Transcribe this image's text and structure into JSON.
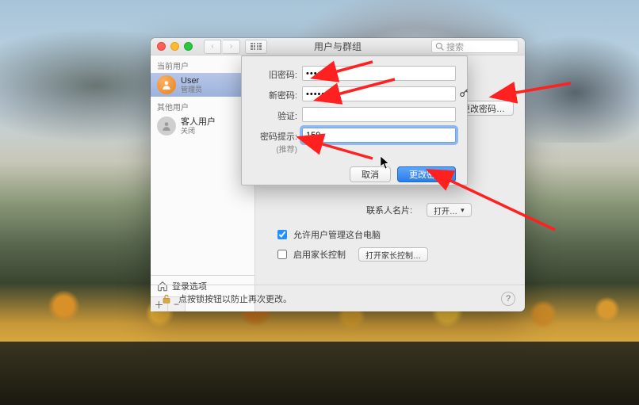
{
  "titlebar": {
    "title": "用户与群组",
    "search_placeholder": "搜索"
  },
  "sidebar": {
    "current_header": "当前用户",
    "other_header": "其他用户",
    "users": [
      {
        "name": "User",
        "sub": "管理员"
      },
      {
        "name": "客人用户",
        "sub": "关闭"
      }
    ],
    "login_options": "登录选项"
  },
  "content": {
    "change_pw_btn": "更改密码…",
    "contact_label": "联系人名片:",
    "open_btn": "打开…",
    "allow_admin_label": "允许用户管理这台电脑",
    "parental_check_label": "启用家长控制",
    "parental_btn": "打开家长控制…"
  },
  "lock_hint": "点按锁按钮以防止再次更改。",
  "sheet": {
    "old_pw_label": "旧密码:",
    "new_pw_label": "新密码:",
    "verify_label": "验证:",
    "hint_label": "密码提示:",
    "hint_sub": "(推荐)",
    "old_pw_value": "••••••",
    "new_pw_value": "••••••",
    "verify_value": "",
    "hint_value": "159",
    "cancel": "取消",
    "confirm": "更改密码"
  }
}
